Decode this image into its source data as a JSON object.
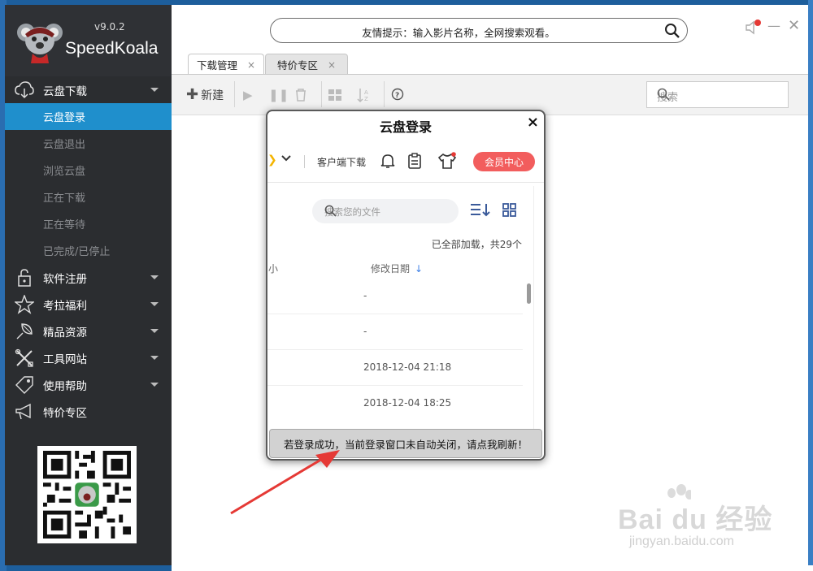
{
  "app": {
    "version": "v9.0.2",
    "name": "SpeedKoala"
  },
  "sidebar": {
    "groups": [
      {
        "label": "云盘下载",
        "icon": "cloud-download-icon"
      },
      {
        "label": "软件注册",
        "icon": "lock-icon"
      },
      {
        "label": "考拉福利",
        "icon": "star-icon"
      },
      {
        "label": "精品资源",
        "icon": "leaf-icon"
      },
      {
        "label": "工具网站",
        "icon": "tools-icon"
      },
      {
        "label": "使用帮助",
        "icon": "tag-icon"
      },
      {
        "label": "特价专区",
        "icon": "megaphone-icon"
      }
    ],
    "subitems": [
      "云盘登录",
      "云盘退出",
      "浏览云盘",
      "正在下载",
      "正在等待",
      "已完成/已停止"
    ],
    "active_subitem": "云盘登录"
  },
  "header": {
    "hint": "友情提示：输入影片名称，全网搜索观看。"
  },
  "tabs": [
    {
      "label": "下载管理",
      "close": "×"
    },
    {
      "label": "特价专区",
      "close": "×"
    }
  ],
  "toolbar": {
    "new_label": "新建",
    "search_placeholder": "搜索"
  },
  "popup": {
    "title": "云盘登录",
    "close": "×",
    "client_download": "客户端下载",
    "vip_button": "会员中心",
    "search_placeholder": "搜索您的文件",
    "loaded_text": "已全部加载，共29个",
    "col_size": "小",
    "col_date": "修改日期",
    "rows": [
      "-",
      "-",
      "2018-12-04 21:18",
      "2018-12-04 18:25"
    ],
    "refresh_text": "若登录成功，当前登录窗口未自动关闭，请点我刷新！"
  },
  "watermark": {
    "brand": "Bai du 经验",
    "url": "jingyan.baidu.com"
  },
  "colors": {
    "sidebar_bg": "#2b2d30",
    "active_blue": "#1f8fcc",
    "vip_red": "#f25d5d",
    "arrow_red": "#e53935"
  }
}
